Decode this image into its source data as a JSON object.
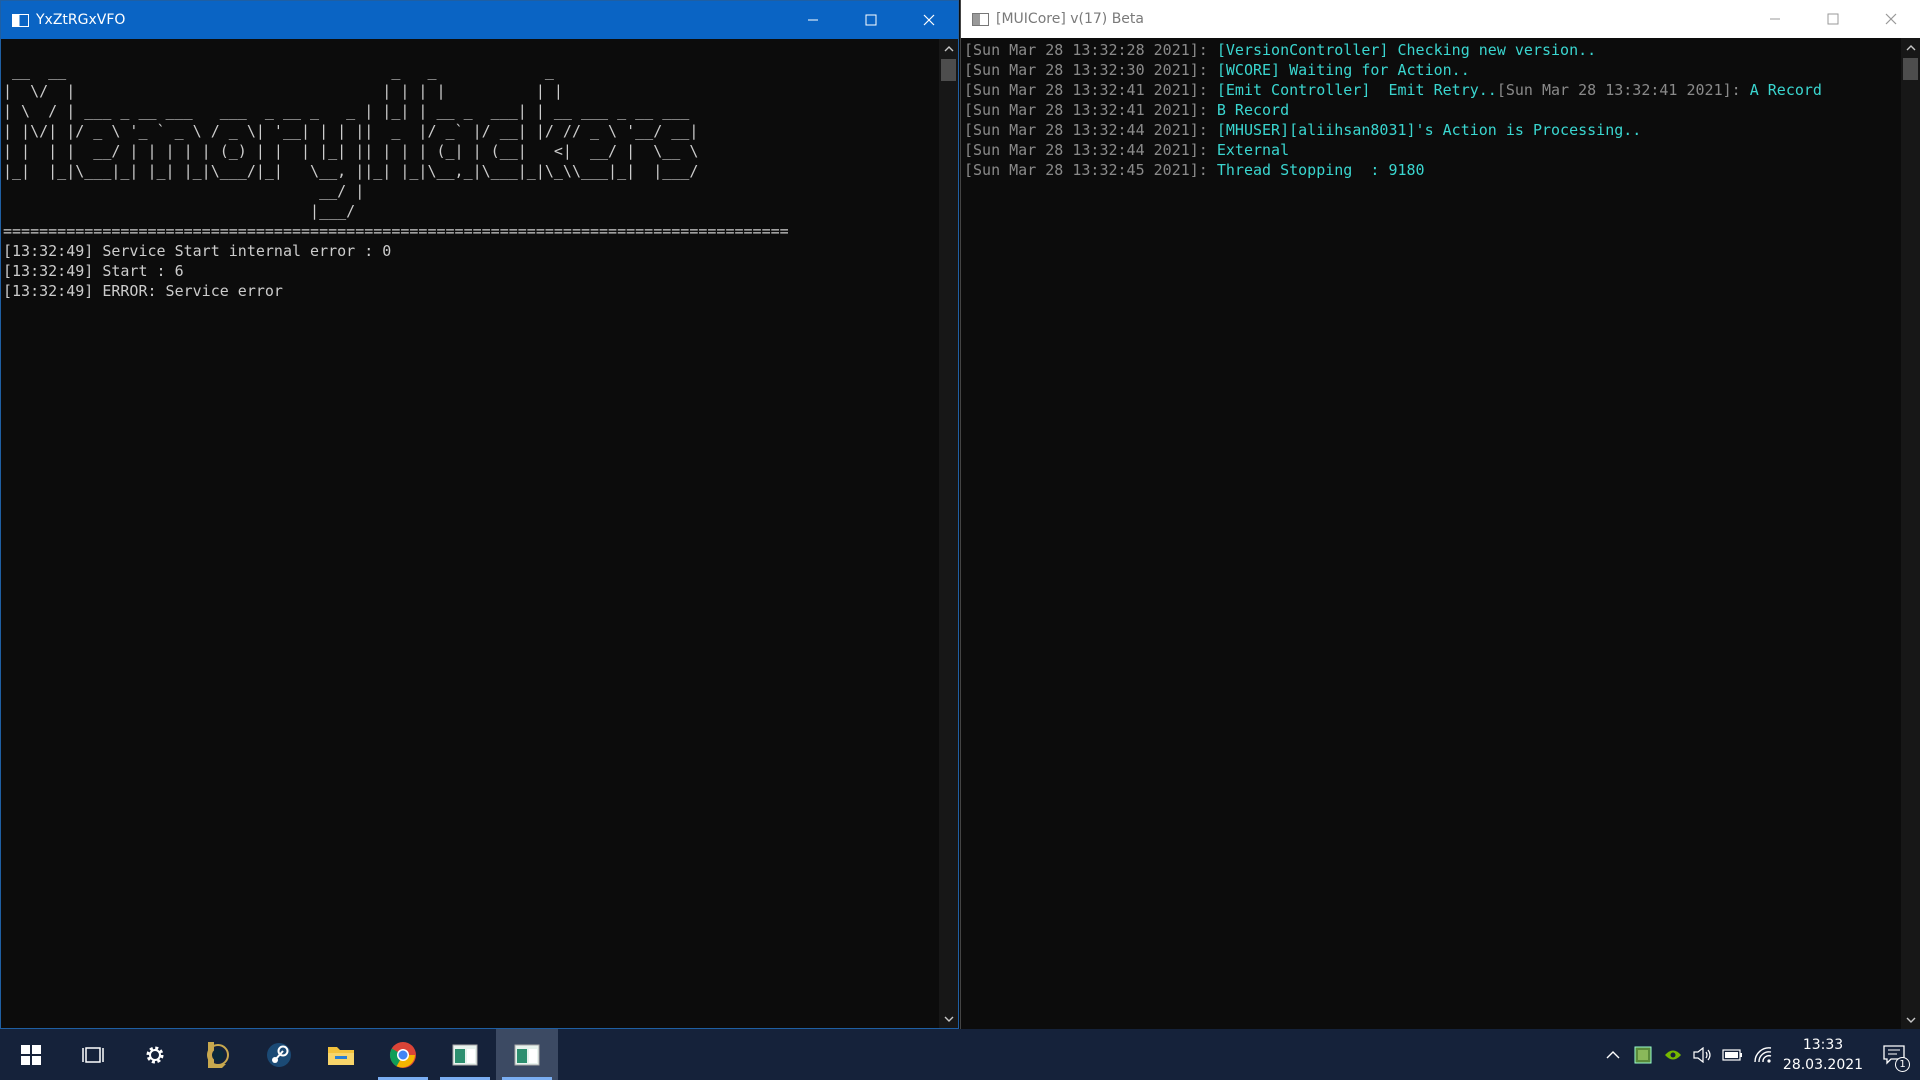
{
  "left_window": {
    "title": "YxZtRGxVFO",
    "banner_lines": [
      " __  __                                    _   _            _",
      "|  \\/  |                                  | | | |          | |",
      "| \\  / | ___ _ __ ___   ___  _ __ _   _ | |_| | __ _  ___| | __ ___ _ __ ___",
      "| |\\/| |/ _ \\ '_ ` _ \\ / _ \\| '__| | | ||  _  |/ _` |/ __| |/ // _ \\ '__/ __|",
      "| |  | |  __/ | | | | | (_) | |  | |_| || | | | (_| | (__|   <|  __/ |  \\__ \\",
      "|_|  |_|\\___|_| |_| |_|\\___/|_|   \\__, ||_| |_|\\__,_|\\___|_|\\_\\\\___|_|  |___/",
      "                                   __/ |",
      "                                  |___/"
    ],
    "separator": "=======================================================================================",
    "log": [
      "[13:32:49] Service Start internal error : 0",
      "",
      "[13:32:49] Start : 6",
      "[13:32:49] ERROR: Service error"
    ]
  },
  "right_window": {
    "title": "[MUICore] v(17) Beta",
    "log": [
      {
        "ts": "[Sun Mar 28 13:32:28 2021]: ",
        "msg": "[VersionController] Checking new version..",
        "ts2": "",
        "msg2": ""
      },
      {
        "ts": "[Sun Mar 28 13:32:30 2021]: ",
        "msg": "[WCORE] Waiting for Action..",
        "ts2": "",
        "msg2": ""
      },
      {
        "ts": "[Sun Mar 28 13:32:41 2021]: ",
        "msg": "[Emit Controller]  Emit Retry..",
        "ts2": "[Sun Mar 28 13:32:41 2021]: ",
        "msg2": "A Record"
      },
      {
        "ts": "[Sun Mar 28 13:32:41 2021]: ",
        "msg": "B Record",
        "ts2": "",
        "msg2": ""
      },
      {
        "ts": "[Sun Mar 28 13:32:44 2021]: ",
        "msg": "[MHUSER][aliihsan8031]'s Action is Processing..",
        "ts2": "",
        "msg2": ""
      },
      {
        "ts": "[Sun Mar 28 13:32:44 2021]: ",
        "msg": "External",
        "ts2": "",
        "msg2": ""
      },
      {
        "ts": "[Sun Mar 28 13:32:45 2021]: ",
        "msg": "Thread Stopping  : 9180",
        "ts2": "",
        "msg2": ""
      }
    ]
  },
  "taskbar": {
    "pinned": [
      "windows-start-icon",
      "task-view-icon",
      "settings-gear-icon",
      "league-of-legends-icon",
      "steam-icon",
      "file-explorer-icon",
      "chrome-icon",
      "console-app-icon",
      "console-app-active-icon"
    ],
    "clock": {
      "time": "13:33",
      "date": "28.03.2021"
    },
    "notification_count": "1"
  },
  "colors": {
    "left_titlebar": "#0a64c4",
    "log_message": "#3ad6d0",
    "taskbar": "#15223a"
  }
}
